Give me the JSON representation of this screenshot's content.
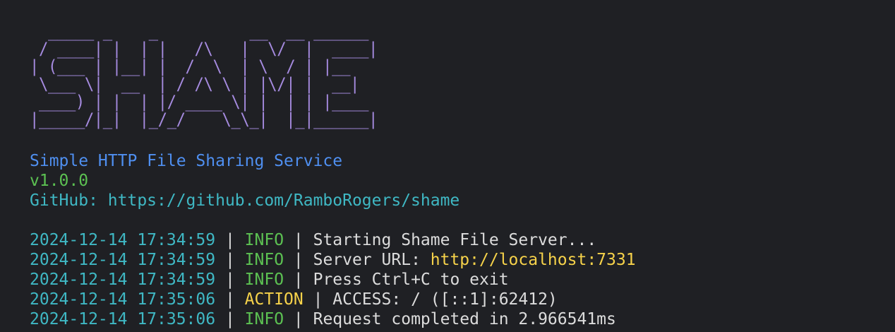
{
  "banner": {
    "ascii_art": "  _____ _    _          __  __ ______\n / ____| |  | |   /\\   |  \\/  |  ____|\n| (___ | |__| |  /  \\  | \\  / | |__\n \\___ \\|  __  | / /\\ \\ | |\\/| |  __|\n ____) | |  | |/ ____ \\| |  | | |____\n|_____/|_|  |_/_/    \\_\\_|  |_|______|"
  },
  "info": {
    "tagline": "Simple HTTP File Sharing Service",
    "version": "v1.0.0",
    "github_label": "GitHub: ",
    "github_url": "https://github.com/RamboRogers/shame"
  },
  "log": {
    "separator": " | ",
    "entries": [
      {
        "timestamp": "2024-12-14 17:34:59",
        "level": "INFO",
        "message": "Starting Shame File Server...",
        "highlight": ""
      },
      {
        "timestamp": "2024-12-14 17:34:59",
        "level": "INFO",
        "message": "Server URL: ",
        "highlight": "http://localhost:7331"
      },
      {
        "timestamp": "2024-12-14 17:34:59",
        "level": "INFO",
        "message": "Press Ctrl+C to exit",
        "highlight": ""
      },
      {
        "timestamp": "2024-12-14 17:35:06",
        "level": "ACTION",
        "message": "ACCESS: / ([::1]:62412)",
        "highlight": ""
      },
      {
        "timestamp": "2024-12-14 17:35:06",
        "level": "INFO",
        "message": "Request completed in 2.966541ms",
        "highlight": ""
      }
    ]
  },
  "colors": {
    "background": "#1f2024",
    "banner": "#a68be0",
    "tagline": "#4f8ff0",
    "version": "#5cc152",
    "timestamp": "#3fb8c4",
    "info_level": "#5cc152",
    "action_level": "#f6d24a",
    "text": "#dcdcdc"
  }
}
